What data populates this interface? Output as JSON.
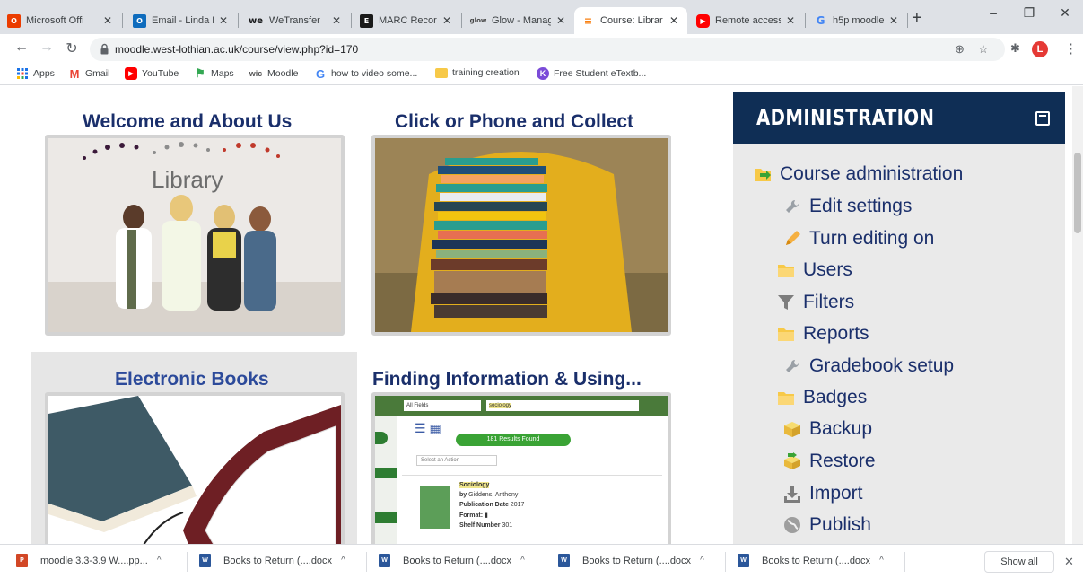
{
  "browser": {
    "tabs": [
      {
        "label": "Microsoft Offi",
        "icon": "office-icon",
        "color": "#eb3c00"
      },
      {
        "label": "Email - Linda H",
        "icon": "outlook-icon",
        "color": "#0f6cbd"
      },
      {
        "label": "WeTransfer",
        "icon": "wetransfer-icon",
        "color": "#17181a"
      },
      {
        "label": "MARC Records",
        "icon": "marc-icon",
        "color": "#1a1a1a"
      },
      {
        "label": "Glow - Manag",
        "icon": "glow-icon",
        "color": "#444444"
      },
      {
        "label": "Course: Librar",
        "icon": "moodle-icon",
        "color": "#f98012",
        "active": true
      },
      {
        "label": "Remote access",
        "icon": "youtube-icon",
        "color": "#ff0000"
      },
      {
        "label": "h5p moodle -",
        "icon": "google-icon",
        "color": "#4285f4"
      }
    ],
    "tab_close_glyph": "✕",
    "new_tab_glyph": "+",
    "window_controls": {
      "minimize": "–",
      "restore": "❐",
      "close": "✕"
    },
    "url": "moodle.west-lothian.ac.uk/course/view.php?id=170",
    "profile_initial": "L",
    "bookmarks": [
      {
        "label": "Apps",
        "icon": "apps-grid-icon",
        "color": "#1a73e8"
      },
      {
        "label": "Gmail",
        "icon": "gmail-icon",
        "color": "#ea4335"
      },
      {
        "label": "YouTube",
        "icon": "youtube-icon",
        "color": "#ff0000"
      },
      {
        "label": "Maps",
        "icon": "maps-icon",
        "color": "#34a853"
      },
      {
        "label": "Moodle",
        "icon": "moodle-icon",
        "color": "#555555"
      },
      {
        "label": "how to video some...",
        "icon": "google-icon",
        "color": "#4285f4"
      },
      {
        "label": "training creation",
        "icon": "folder-icon",
        "color": "#f7c948"
      },
      {
        "label": "Free Student eTextb...",
        "icon": "k-icon",
        "color": "#7b4bd8"
      }
    ]
  },
  "course_tiles": [
    {
      "title": "Welcome and About Us",
      "image": "library-staff-photo"
    },
    {
      "title": "Click or Phone and Collect",
      "image": "stack-of-books-photo"
    },
    {
      "title": "Electronic Books",
      "image": "ebook-reader-photo",
      "highlighted": true
    },
    {
      "title": "Finding Information & Using...",
      "image": "library-catalogue-screenshot"
    }
  ],
  "catalogue_mock": {
    "field": "All Fields",
    "query": "sociology",
    "results_found": "181 Results Found",
    "select_action": "Select an Action",
    "result_title": "Sociology",
    "by_label": "by",
    "author": "Giddens, Anthony",
    "pub_label": "Publication Date",
    "pub_value": "2017",
    "format_label": "Format:",
    "shelf_label": "Shelf Number",
    "shelf_value": "301"
  },
  "administration": {
    "title": "ADMINISTRATION",
    "items": [
      {
        "label": "Course administration",
        "icon": "folder-open-arrow-icon",
        "level": 0
      },
      {
        "label": "Edit settings",
        "icon": "wrench-icon",
        "level": 1
      },
      {
        "label": "Turn editing on",
        "icon": "pencil-icon",
        "level": 1
      },
      {
        "label": "Users",
        "icon": "folder-icon",
        "level": 1
      },
      {
        "label": "Filters",
        "icon": "filter-icon",
        "level": 1
      },
      {
        "label": "Reports",
        "icon": "folder-icon",
        "level": 1
      },
      {
        "label": "Gradebook setup",
        "icon": "wrench-icon",
        "level": 1
      },
      {
        "label": "Badges",
        "icon": "folder-icon",
        "level": 1
      },
      {
        "label": "Backup",
        "icon": "backup-box-icon",
        "level": 1
      },
      {
        "label": "Restore",
        "icon": "restore-box-icon",
        "level": 1
      },
      {
        "label": "Import",
        "icon": "import-icon",
        "level": 1
      },
      {
        "label": "Publish",
        "icon": "globe-icon",
        "level": 1
      }
    ]
  },
  "downloads": [
    {
      "label": "moodle 3.3-3.9 W....pp...",
      "type": "ppt"
    },
    {
      "label": "Books to Return (....docx",
      "type": "docx"
    },
    {
      "label": "Books to Return (....docx",
      "type": "docx"
    },
    {
      "label": "Books to Return (....docx",
      "type": "docx"
    },
    {
      "label": "Books to Return (....docx",
      "type": "docx"
    }
  ],
  "download_bar": {
    "show_all": "Show all",
    "chevron": "^",
    "close": "✕"
  }
}
